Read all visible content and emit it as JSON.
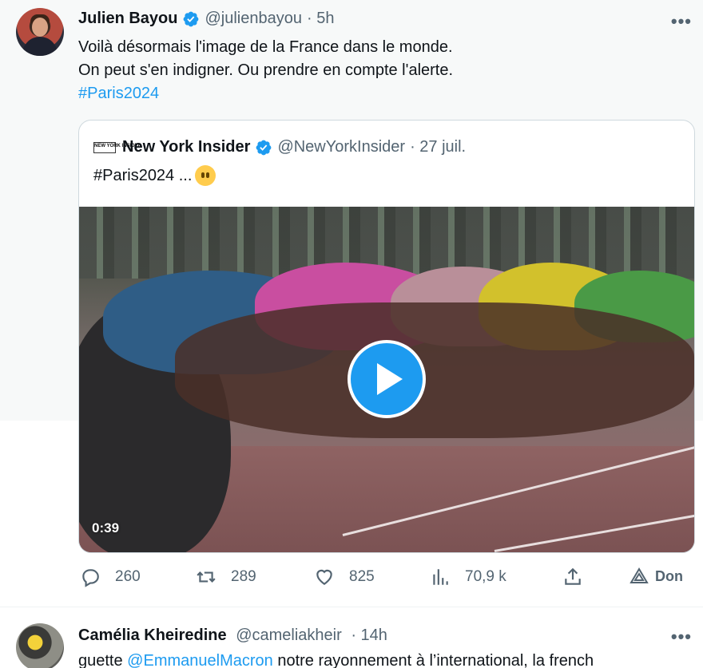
{
  "tweet": {
    "author_name": "Julien Bayou",
    "author_handle": "@julienbayou",
    "time": "· 5h",
    "more": "•••",
    "text_lines": [
      "Voilà désormais l'image de la France dans le monde.",
      "On peut s'en indigner. Ou prendre en compte l'alerte."
    ],
    "hashtag": "#Paris2024",
    "quote": {
      "logo_text": "NEW YORK INSIDER",
      "author_name": "New York Insider",
      "author_handle": "@NewYorkInsider",
      "time": "· 27 juil.",
      "text": "#Paris2024 ...",
      "emoji": "no-mouth-face-emoji",
      "video_duration": "0:39"
    },
    "actions": {
      "replies": "260",
      "retweets": "289",
      "likes": "825",
      "views": "70,9 k",
      "donate_label": "Don"
    }
  },
  "tweet2": {
    "author_name": "Camélia Kheiredine",
    "author_handle": "@cameliakheir",
    "time": "· 14h",
    "more": "•••",
    "text_prefix": "guette ",
    "mention": "@EmmanuelMacron",
    "text_suffix": " notre rayonnement à l’international, la french"
  },
  "colors": {
    "accent": "#1d9bf0",
    "secondary_text": "#536471",
    "border": "#cfd9de"
  }
}
